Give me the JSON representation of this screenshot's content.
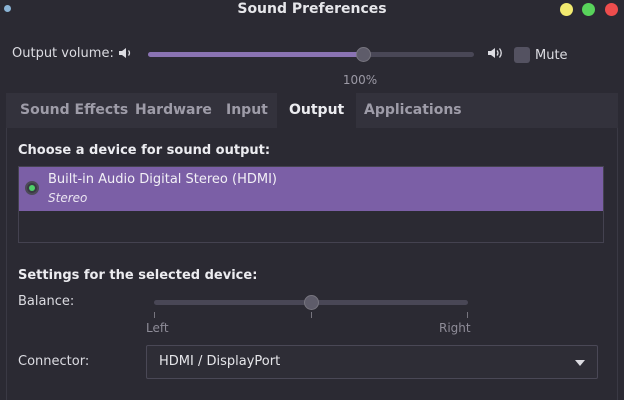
{
  "window": {
    "title": "Sound Preferences"
  },
  "volume": {
    "label": "Output volume:",
    "level_percent": 66,
    "value_text": "100%",
    "mute_label": "Mute",
    "mute_checked": false,
    "low_icon": "speaker-low-icon",
    "high_icon": "speaker-high-icon"
  },
  "tabs": [
    {
      "label": "Sound Effects",
      "active": false
    },
    {
      "label": "Hardware",
      "active": false
    },
    {
      "label": "Input",
      "active": false
    },
    {
      "label": "Output",
      "active": true
    },
    {
      "label": "Applications",
      "active": false
    }
  ],
  "output": {
    "device_heading": "Choose a device for sound output:",
    "devices": [
      {
        "name": "Built-in Audio Digital Stereo (HDMI)",
        "profile": "Stereo",
        "selected": true
      }
    ],
    "settings_heading": "Settings for the selected device:",
    "balance": {
      "label": "Balance:",
      "value": 0,
      "left_label": "Left",
      "right_label": "Right"
    },
    "connector": {
      "label": "Connector:",
      "value": "HDMI / DisplayPort"
    }
  },
  "colors": {
    "accent": "#7b5fa6",
    "slider_fill": "#8a73b3",
    "radio_active": "#4fd06a",
    "close": "#ee4d4d",
    "maximize": "#58d35b",
    "minimize": "#f2ea70"
  }
}
